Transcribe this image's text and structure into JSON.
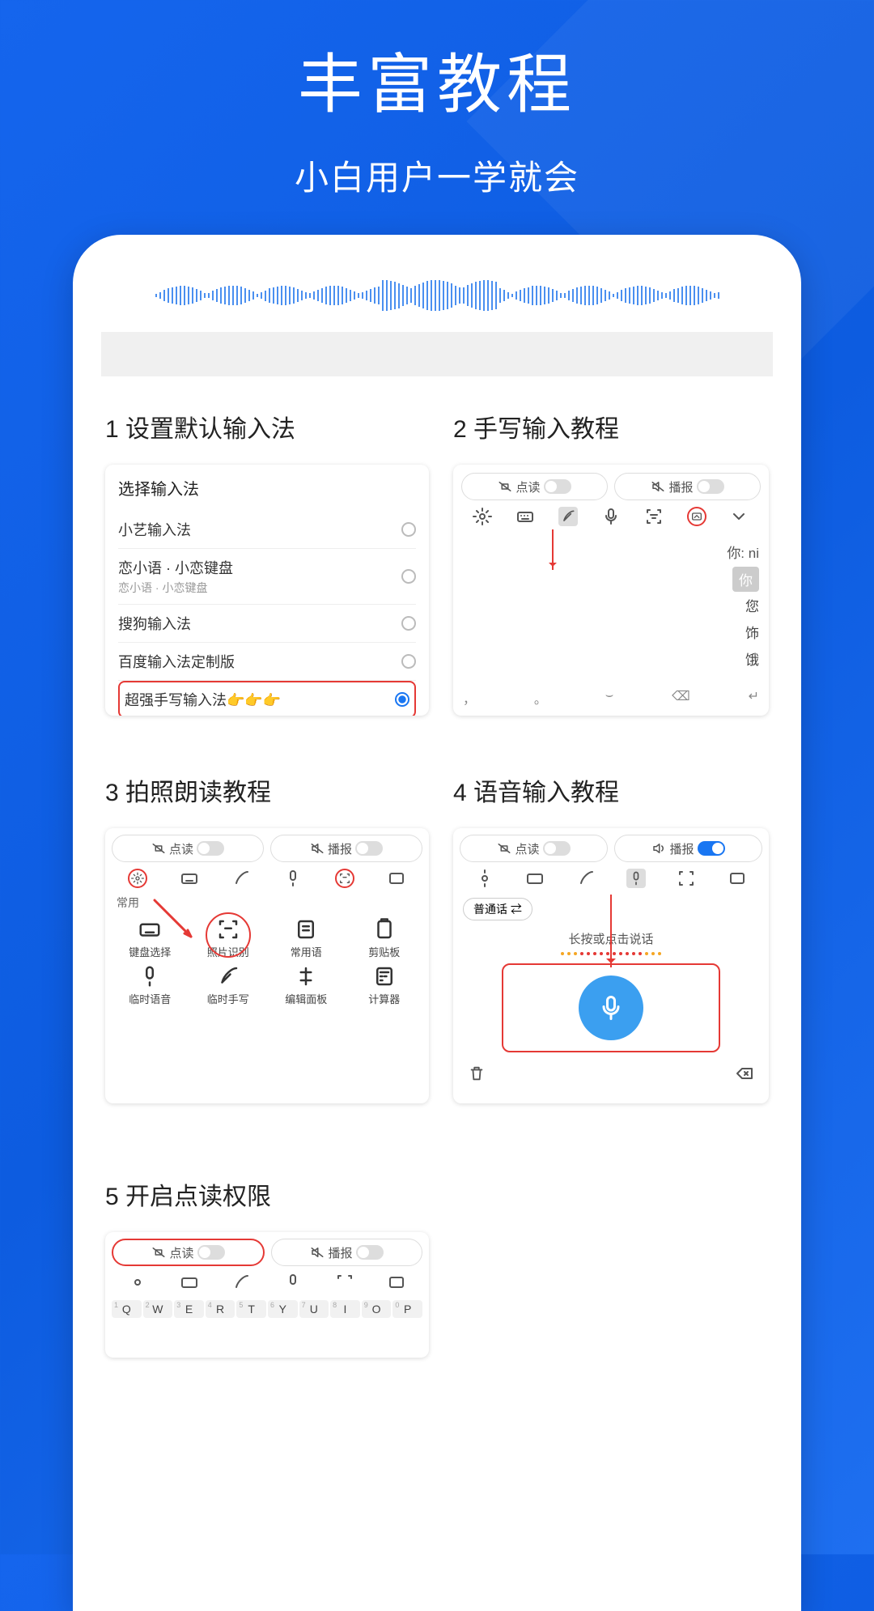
{
  "hero": {
    "title": "丰富教程",
    "subtitle": "小白用户一学就会"
  },
  "tutorials": [
    {
      "num": "1",
      "title": "设置默认输入法",
      "ime_selector": {
        "heading": "选择输入法",
        "options": [
          {
            "label": "小艺输入法",
            "sub": null,
            "selected": false
          },
          {
            "label": "恋小语 · 小恋键盘",
            "sub": "恋小语 · 小恋键盘",
            "selected": false
          },
          {
            "label": "搜狗输入法",
            "sub": null,
            "selected": false
          },
          {
            "label": "百度输入法定制版",
            "sub": null,
            "selected": false
          },
          {
            "label": "超强手写输入法👉👉👉",
            "sub": null,
            "selected": true,
            "highlight": true
          }
        ]
      }
    },
    {
      "num": "2",
      "title": "手写输入教程",
      "toggles": {
        "left": "点读",
        "right": "播报",
        "left_on": false,
        "right_on": false
      },
      "candidates_label": "你:  ni",
      "candidates": [
        "你",
        "您",
        "饰",
        "饿"
      ],
      "bottom_symbols": [
        "，",
        "。",
        "⌣",
        "⌫",
        "↵"
      ]
    },
    {
      "num": "3",
      "title": "拍照朗读教程",
      "toggles": {
        "left": "点读",
        "right": "播报",
        "left_on": false,
        "right_on": false
      },
      "section_label": "常用",
      "grid": [
        {
          "icon": "keyboard",
          "label": "键盘选择"
        },
        {
          "icon": "scan",
          "label": "照片识别",
          "circled": true
        },
        {
          "icon": "note",
          "label": "常用语"
        },
        {
          "icon": "clipboard",
          "label": "剪贴板"
        },
        {
          "icon": "mic",
          "label": "临时语音"
        },
        {
          "icon": "feather",
          "label": "临时手写"
        },
        {
          "icon": "cursor",
          "label": "编辑面板"
        },
        {
          "icon": "calc",
          "label": "计算器"
        }
      ],
      "toolbar_highlight": "scan"
    },
    {
      "num": "4",
      "title": "语音输入教程",
      "toggles": {
        "left": "点读",
        "right": "播报",
        "left_on": false,
        "right_on": true
      },
      "language_pill": "普通话 ⇄",
      "hint": "长按或点击说话",
      "toolbar_highlight": "mic",
      "bottom_icons": {
        "left": "trash",
        "right": "backspace"
      }
    },
    {
      "num": "5",
      "title": "开启点读权限",
      "toggles": {
        "left": "点读",
        "right": "播报",
        "left_on": false,
        "right_on": false,
        "left_boxed": true
      },
      "qwerty": [
        "Q",
        "W",
        "E",
        "R",
        "T",
        "Y",
        "U",
        "I",
        "O",
        "P"
      ],
      "qwerty_nums": [
        "1",
        "2",
        "3",
        "4",
        "5",
        "6",
        "7",
        "8",
        "9",
        "0"
      ]
    }
  ]
}
